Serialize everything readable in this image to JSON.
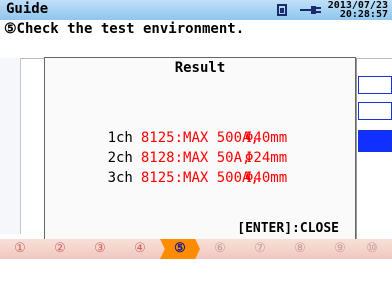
{
  "header": {
    "title": "Guide",
    "date": "2013/07/23",
    "time": "20:28:57",
    "instruction": "⑤Check the test environment."
  },
  "dialog": {
    "title": "Result",
    "rows": [
      {
        "channel": "1ch",
        "info": "8125:MAX 500A,",
        "diameter": "Φ40mm"
      },
      {
        "channel": "2ch",
        "info": "8128:MAX 50A,",
        "diameter": "Φ24mm"
      },
      {
        "channel": "3ch",
        "info": "8125:MAX 500A,",
        "diameter": "Φ40mm"
      }
    ],
    "close_label": "[ENTER]:CLOSE"
  },
  "steps": [
    "①",
    "②",
    "③",
    "④",
    "⑤",
    "⑥",
    "⑦",
    "⑧",
    "⑨",
    "⑩"
  ],
  "active_step": 5,
  "colors": {
    "accent": "#ff8c00",
    "value_text": "#ff0000",
    "header_bg": "#9dcdf0"
  },
  "icons": [
    "battery-icon",
    "ac-plug-icon"
  ]
}
